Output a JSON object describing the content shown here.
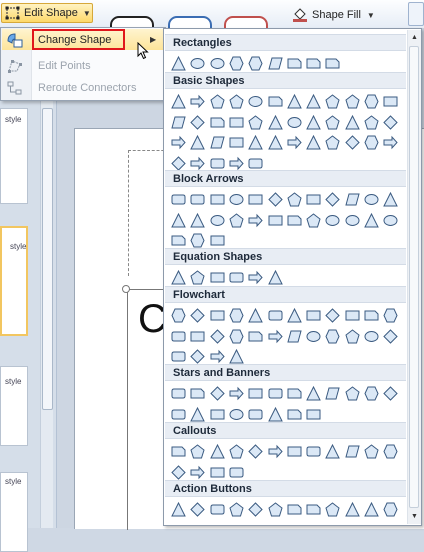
{
  "ribbon": {
    "edit_shape_label": "Edit Shape",
    "shape_fill_label": "Shape Fill"
  },
  "edit_menu": {
    "items": [
      {
        "label": "Change Shape",
        "state": "highlighted",
        "icon": "change-shape-icon"
      },
      {
        "label": "Edit Points",
        "state": "disabled",
        "icon": "edit-points-icon"
      },
      {
        "label": "Reroute Connectors",
        "state": "disabled",
        "icon": "reroute-connectors-icon"
      }
    ]
  },
  "thumbnails": {
    "labels": [
      "style",
      "style",
      "style",
      "style"
    ]
  },
  "slide": {
    "letter": "C"
  },
  "gallery": {
    "sections": [
      {
        "title": "Rectangles",
        "shapes": [
          "rect",
          "rounded-rect",
          "snip-corner",
          "snip-same-side",
          "snip-diagonal",
          "snip-round",
          "round-one-corner",
          "round-same-side",
          "round-diagonal"
        ]
      },
      {
        "title": "Basic Shapes",
        "shapes": [
          "oval",
          "triangle",
          "right-triangle",
          "parallelogram",
          "trapezoid",
          "diamond",
          "pentagon",
          "hexagon",
          "heptagon",
          "octagon",
          "decagon",
          "dodecagon",
          "pie",
          "chord",
          "teardrop",
          "frame",
          "half-frame",
          "l-shape",
          "diagonal-stripe",
          "cross",
          "plaque",
          "can",
          "cube",
          "bevel",
          "donut",
          "no-symbol",
          "block-arc",
          "folded-corner",
          "smiley",
          "heart",
          "lightning",
          "sun",
          "moon",
          "cloud",
          "arc",
          "double-bracket",
          "double-brace",
          "left-bracket",
          "right-bracket",
          "left-brace",
          "right-brace"
        ]
      },
      {
        "title": "Block Arrows",
        "shapes": [
          "arrow-right",
          "arrow-left",
          "arrow-up",
          "arrow-down",
          "arrow-left-right",
          "arrow-up-down",
          "quad-arrow",
          "left-right-up",
          "bent-arrow",
          "u-turn",
          "left-up-arrow",
          "bent-up-arrow",
          "curved-right",
          "curved-left",
          "curved-up",
          "curved-down",
          "striped-right",
          "notched-right",
          "pentagon-arrow",
          "chevron",
          "right-callout",
          "down-callout",
          "left-callout",
          "up-callout",
          "left-right-callout",
          "quad-callout",
          "circular-arrow"
        ]
      },
      {
        "title": "Equation Shapes",
        "shapes": [
          "plus",
          "minus",
          "multiply",
          "division",
          "equal",
          "not-equal"
        ]
      },
      {
        "title": "Flowchart",
        "shapes": [
          "process",
          "alternate-process",
          "decision",
          "data",
          "predefined",
          "internal-storage",
          "document",
          "multidocument",
          "terminator",
          "preparation",
          "manual-input",
          "manual-operation",
          "connector",
          "offpage-connector",
          "card",
          "punched-tape",
          "summing-junction",
          "or",
          "collate",
          "sort",
          "extract",
          "merge",
          "stored-data",
          "delay",
          "sequential-access",
          "magnetic-disk",
          "direct-access",
          "display"
        ]
      },
      {
        "title": "Stars and Banners",
        "shapes": [
          "explosion-1",
          "explosion-2",
          "star-4",
          "star-5",
          "star-6",
          "star-7",
          "star-8",
          "star-10",
          "star-12",
          "star-16",
          "star-24",
          "star-32",
          "up-ribbon",
          "down-ribbon",
          "curved-up-ribbon",
          "curved-down-ribbon",
          "vertical-scroll",
          "horizontal-scroll",
          "wave",
          "double-wave"
        ]
      },
      {
        "title": "Callouts",
        "shapes": [
          "rect-callout",
          "rounded-callout",
          "oval-callout",
          "cloud-callout",
          "line-callout-1",
          "line-callout-2",
          "line-callout-3",
          "line-callout-4",
          "accent-callout-1",
          "accent-callout-2",
          "accent-callout-3",
          "accent-callout-4",
          "border-callout-1",
          "border-callout-2",
          "border-callout-3",
          "border-callout-4"
        ]
      },
      {
        "title": "Action Buttons",
        "shapes": [
          "back",
          "forward",
          "beginning",
          "end",
          "home",
          "information",
          "return",
          "movie",
          "document",
          "sound",
          "help",
          "custom"
        ]
      }
    ]
  },
  "colors": {
    "highlight_border": "#e0161b",
    "shape_stroke": "#3a5a80",
    "shape_fill": "#dbe8f6"
  }
}
